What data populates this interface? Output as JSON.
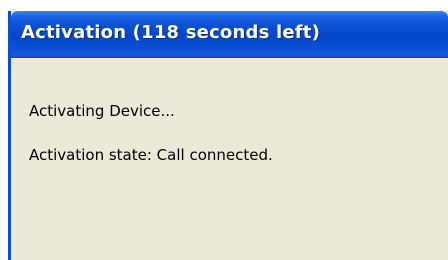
{
  "dialog": {
    "title": "Activation (118 seconds left)",
    "message": "Activating Device...",
    "state": "Activation state: Call connected."
  },
  "colors": {
    "titlebar": "#0a4fd2",
    "body": "#ece9d8",
    "title_text": "#ffffff"
  }
}
